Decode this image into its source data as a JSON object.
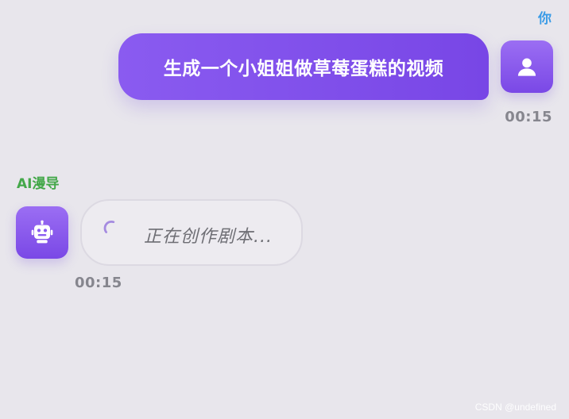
{
  "user_message": {
    "sender": "你",
    "text": "生成一个小姐姐做草莓蛋糕的视频",
    "time": "00:15",
    "avatar_icon": "user-icon"
  },
  "ai_message": {
    "sender": "AI漫导",
    "status_text": "正在创作剧本...",
    "time": "00:15",
    "avatar_icon": "robot-icon",
    "loading": true
  },
  "watermark": "CSDN @undefined",
  "colors": {
    "accent": "#7c4ae8",
    "user_name": "#3a9be6",
    "ai_name": "#44a84a",
    "background": "#e8e6ec"
  }
}
